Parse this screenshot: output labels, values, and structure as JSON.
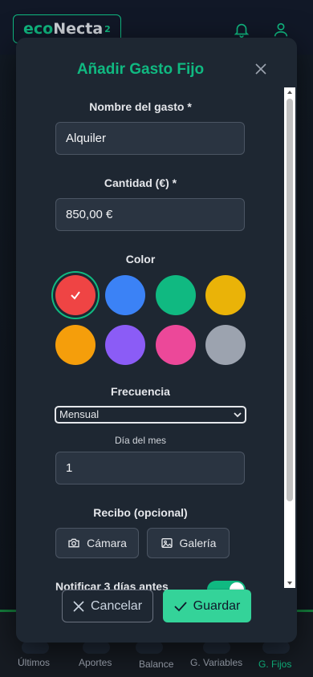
{
  "app": {
    "logo_prefix": "eco",
    "logo_main": "Necta",
    "logo_sup": "2"
  },
  "nav": {
    "items": [
      {
        "label": "Últimos",
        "active": false
      },
      {
        "label": "Aportes",
        "active": false
      },
      {
        "label": "Balance",
        "active": false
      },
      {
        "label": "G. Variables",
        "active": false
      },
      {
        "label": "G. Fijos",
        "active": true
      }
    ]
  },
  "modal": {
    "title": "Añadir Gasto Fijo",
    "name_label": "Nombre del gasto *",
    "name_value": "Alquiler",
    "amount_label": "Cantidad (€) *",
    "amount_value": "850,00 €",
    "color_label": "Color",
    "colors": [
      "#ef4444",
      "#3b82f6",
      "#10b981",
      "#eab308",
      "#f59e0b",
      "#8b5cf6",
      "#ec4899",
      "#9ca3af"
    ],
    "selected_color_index": 0,
    "frequency_label": "Frecuencia",
    "frequency_value": "Mensual",
    "day_label": "Día del mes",
    "day_value": "1",
    "receipt_label": "Recibo (opcional)",
    "camera_label": "Cámara",
    "gallery_label": "Galería",
    "notify_label": "Notificar 3 días antes",
    "notify_on": true,
    "cancel_label": "Cancelar",
    "save_label": "Guardar"
  },
  "colors": {
    "accent": "#10b981",
    "modal_bg": "#1e2732",
    "input_bg": "#2a3441",
    "save_bg": "#34d399"
  }
}
